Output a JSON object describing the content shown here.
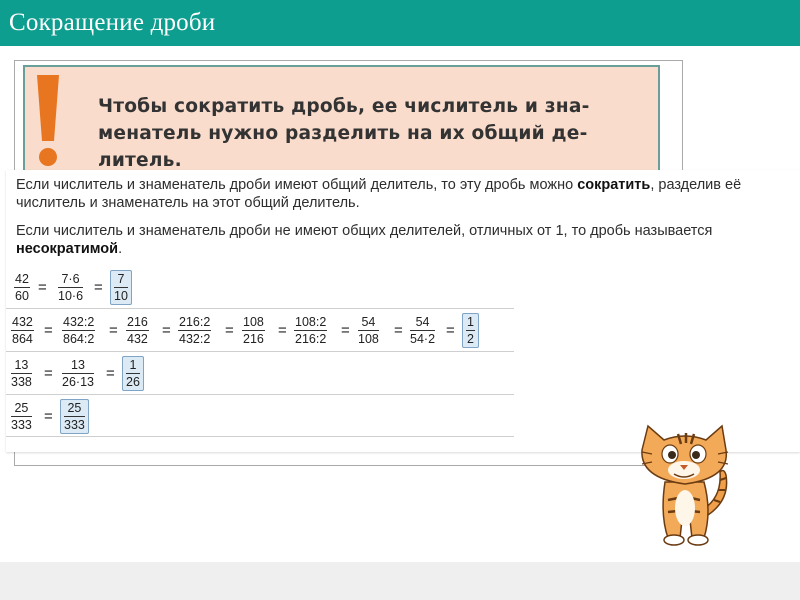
{
  "title": "Сокращение дроби",
  "rule": {
    "text": "Чтобы сократить дробь, ее числитель и зна-менатель нужно разделить на их общий де-литель."
  },
  "definition": {
    "p1_before": "Если числитель и знаменатель дроби имеют общий делитель, то эту дробь можно ",
    "p1_bold": "сократить",
    "p1_after": ", разделив её числитель и знаменатель на этот общий делитель.",
    "p2_before": "Если числитель и знаменатель дроби не имеют общих делителей, отличных от 1, то дробь называется ",
    "p2_bold": "несократимой",
    "p2_after": "."
  },
  "examples": {
    "r1": {
      "f1n": "42",
      "f1d": "60",
      "f2n": "7·6",
      "f2d": "10·6",
      "f3n": "7",
      "f3d": "10"
    },
    "r2": {
      "f1n": "432",
      "f1d": "864",
      "f2n": "432:2",
      "f2d": "864:2",
      "f3n": "216",
      "f3d": "432",
      "f4n": "216:2",
      "f4d": "432:2",
      "f5n": "108",
      "f5d": "216",
      "f6n": "108:2",
      "f6d": "216:2",
      "f7n": "54",
      "f7d": "108",
      "f8n": "54",
      "f8d": "54·2",
      "f9n": "1",
      "f9d": "2"
    },
    "r3": {
      "f1n": "13",
      "f1d": "338",
      "f2n": "13",
      "f2d": "26·13",
      "f3n": "1",
      "f3d": "26"
    },
    "r4": {
      "f1n": "25",
      "f1d": "333",
      "f2n": "25",
      "f2d": "333"
    },
    "eq": "="
  },
  "colors": {
    "title_bar": "#0e9e8f",
    "rule_bg": "#f9dccc",
    "rule_border": "#6a9e98",
    "exclamation": "#e87620",
    "answer_box": "#dceaf5"
  }
}
